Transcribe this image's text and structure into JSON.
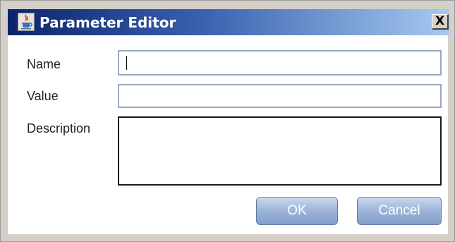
{
  "window": {
    "title": "Parameter Editor",
    "close_glyph": "X"
  },
  "icons": {
    "app": "java-cup-icon",
    "close": "close-icon"
  },
  "form": {
    "name_label": "Name",
    "name_value": "",
    "value_label": "Value",
    "value_value": "",
    "description_label": "Description",
    "description_value": ""
  },
  "buttons": {
    "ok": "OK",
    "cancel": "Cancel"
  },
  "colors": {
    "title_gradient_start": "#0a246a",
    "title_gradient_end": "#a6caf0",
    "button_fill": "#9db4d8",
    "button_text": "#ffffff"
  }
}
